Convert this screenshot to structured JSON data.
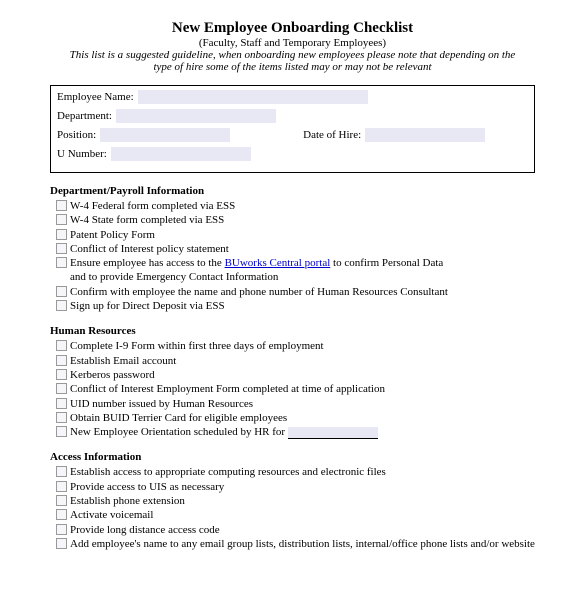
{
  "header": {
    "title": "New Employee Onboarding Checklist",
    "subtitle": "(Faculty, Staff and Temporary Employees)",
    "note": "This list is a suggested guideline, when onboarding new employees please note that depending on the type of hire some of the items listed may or may not be relevant"
  },
  "info": {
    "employee_name_label": "Employee Name:",
    "department_label": "Department:",
    "position_label": "Position:",
    "date_of_hire_label": "Date of Hire:",
    "u_number_label": "U Number:"
  },
  "sections": {
    "dept_payroll": {
      "title": "Department/Payroll Information",
      "items": {
        "i0": "W-4 Federal form completed via ESS",
        "i1": "W-4 State form completed via ESS",
        "i2": "Patent Policy Form",
        "i3": "Conflict of Interest policy statement",
        "i4a": "Ensure employee has access to the ",
        "i4link": "BUworks Central portal",
        "i4b": " to confirm Personal Data",
        "i4c": "and to provide Emergency Contact Information",
        "i5": "Confirm with employee the name and phone number of Human Resources Consultant",
        "i6": "Sign up for Direct Deposit via ESS"
      }
    },
    "hr": {
      "title": "Human Resources",
      "items": {
        "i0": "Complete I-9 Form within first three days of employment",
        "i1": "Establish Email account",
        "i2": "Kerberos password",
        "i3": "Conflict of Interest Employment Form completed at time of application",
        "i4": "UID number issued by Human Resources",
        "i5": "Obtain BUID Terrier Card for eligible employees",
        "i6": "New Employee Orientation scheduled by HR for "
      }
    },
    "access": {
      "title": "Access Information",
      "items": {
        "i0": "Establish access to appropriate computing resources and electronic files",
        "i1": "Provide access to UIS as necessary",
        "i2": "Establish phone extension",
        "i3": "Activate voicemail",
        "i4": "Provide long distance access code",
        "i5": "Add employee's name to any email group lists, distribution lists, internal/office phone lists and/or website"
      }
    }
  }
}
